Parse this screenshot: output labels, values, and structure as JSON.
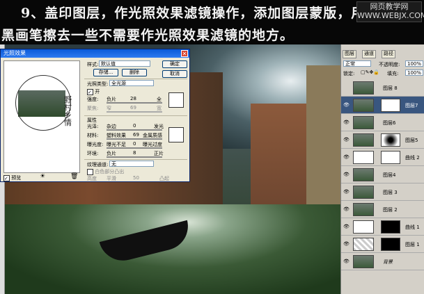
{
  "banner": {
    "line1": "9、盖印图层，作光照效果滤镜操作，添加图层蒙版，用",
    "line2": "黑画笔擦去一些不需要作光照效果滤镜的地方。",
    "watermark_line1": "网页教学网",
    "watermark_line2": "WWW.WEBJX.COM"
  },
  "dialog": {
    "title": "光照效果",
    "style_label": "样式:",
    "style_value": "默认值",
    "save_label": "存储...",
    "delete_label": "删除",
    "ok_label": "确定",
    "cancel_label": "取消",
    "light_type_label": "光照类型:",
    "light_type_value": "全光源",
    "on_label": "开",
    "intensity_label": "强度:",
    "intensity_low": "负片",
    "intensity_value": "28",
    "intensity_high": "全",
    "focus_label": "聚焦:",
    "focus_low": "窄",
    "focus_value": "69",
    "focus_high": "宽",
    "properties_label": "属性",
    "gloss_label": "光泽:",
    "gloss_low": "杂边",
    "gloss_value": "0",
    "gloss_high": "发光",
    "material_label": "材料:",
    "material_low": "塑料效果",
    "material_value": "69",
    "material_high": "金属质感",
    "exposure_label": "曝光度:",
    "exposure_low": "曝光不足",
    "exposure_value": "0",
    "exposure_high": "曝光过度",
    "ambience_label": "环境:",
    "ambience_low": "负片",
    "ambience_value": "8",
    "ambience_high": "正片",
    "texture_label": "纹理通道:",
    "texture_value": "无",
    "white_high_label": "白色部分凸出",
    "height_label": "高度",
    "height_low": "平滑",
    "height_value": "50",
    "height_high": "凸起",
    "preview_label": "预览"
  },
  "layers_panel": {
    "tabs": [
      "图层",
      "通道",
      "路径"
    ],
    "blend_mode": "正常",
    "opacity_label": "不透明度:",
    "opacity_value": "100%",
    "lock_label": "锁定:",
    "fill_label": "填充:",
    "fill_value": "100%",
    "layers": [
      {
        "name": "图层 8",
        "visible": false,
        "mask": "none",
        "selected": false
      },
      {
        "name": "图层7",
        "visible": true,
        "mask": "white-brush",
        "selected": true
      },
      {
        "name": "图层6",
        "visible": true,
        "mask": "none",
        "selected": false
      },
      {
        "name": "图层5",
        "visible": true,
        "mask": "radial",
        "selected": false
      },
      {
        "name": "曲线 2",
        "visible": true,
        "mask": "white",
        "selected": false
      },
      {
        "name": "图层4",
        "visible": true,
        "mask": "none",
        "selected": false
      },
      {
        "name": "图层 3",
        "visible": true,
        "mask": "none",
        "selected": false
      },
      {
        "name": "图层 2",
        "visible": true,
        "mask": "none",
        "selected": false
      },
      {
        "name": "曲线 1",
        "visible": true,
        "mask": "black",
        "selected": false
      },
      {
        "name": "图层 1",
        "visible": true,
        "mask": "black",
        "selected": false
      },
      {
        "name": "背景",
        "visible": true,
        "mask": "none",
        "selected": false
      }
    ]
  }
}
